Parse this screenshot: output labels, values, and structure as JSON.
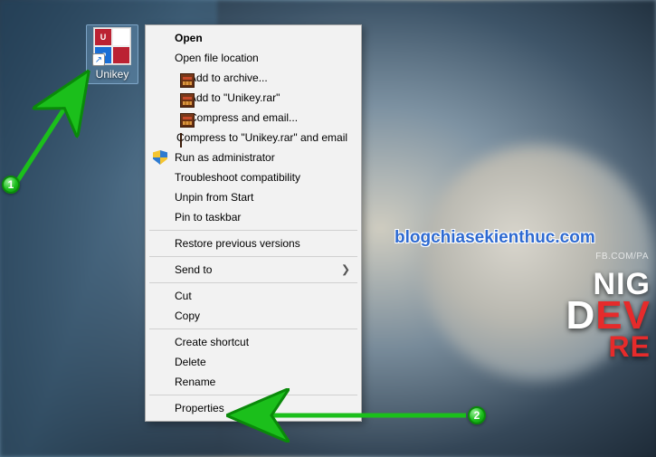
{
  "desktop_icon": {
    "label": "Unikey"
  },
  "context_menu": {
    "open": "Open",
    "open_file_location": "Open file location",
    "add_to_archive": "Add to archive...",
    "add_to_named_rar": "Add to \"Unikey.rar\"",
    "compress_email": "Compress and email...",
    "compress_named_email": "Compress to \"Unikey.rar\" and email",
    "run_as_admin": "Run as administrator",
    "troubleshoot": "Troubleshoot compatibility",
    "unpin_start": "Unpin from Start",
    "pin_taskbar": "Pin to taskbar",
    "restore_versions": "Restore previous versions",
    "send_to": "Send to",
    "cut": "Cut",
    "copy": "Copy",
    "create_shortcut": "Create shortcut",
    "delete": "Delete",
    "rename": "Rename",
    "properties": "Properties"
  },
  "annotations": {
    "badge1": "1",
    "badge2": "2"
  },
  "watermark": "blogchiasekienthuc.com",
  "wallpaper_text": {
    "credit": "FB.COM/PA",
    "line1": "NIG",
    "line2_white": "D",
    "line2_red": "EV",
    "line3": "RE"
  }
}
